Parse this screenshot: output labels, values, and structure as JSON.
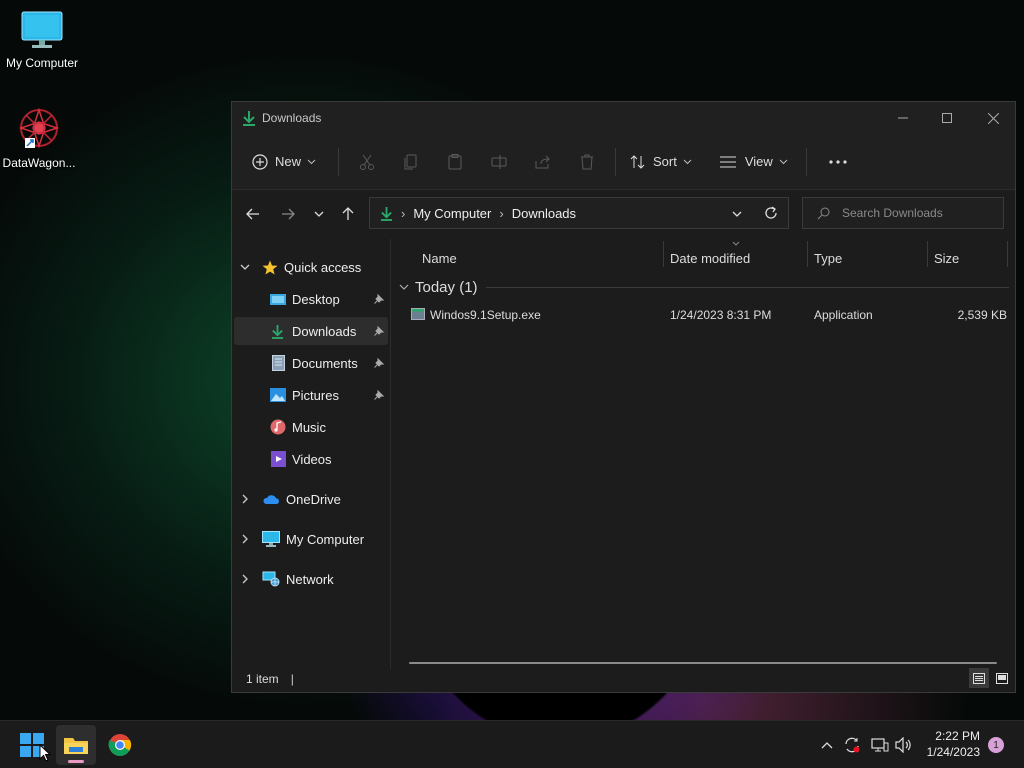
{
  "desktop": {
    "icons": [
      {
        "label": "My Computer"
      },
      {
        "label": "DataWagon..."
      }
    ]
  },
  "window": {
    "title": "Downloads",
    "toolbar": {
      "new_label": "New",
      "sort_label": "Sort",
      "view_label": "View"
    },
    "address": {
      "crumbs": [
        "My Computer",
        "Downloads"
      ],
      "search_placeholder": "Search Downloads"
    },
    "sidebar": {
      "quick_access": "Quick access",
      "items": [
        {
          "label": "Desktop",
          "pinned": true
        },
        {
          "label": "Downloads",
          "pinned": true,
          "selected": true
        },
        {
          "label": "Documents",
          "pinned": true
        },
        {
          "label": "Pictures",
          "pinned": true
        },
        {
          "label": "Music",
          "pinned": false
        },
        {
          "label": "Videos",
          "pinned": false
        }
      ],
      "roots": [
        "OneDrive",
        "My Computer",
        "Network"
      ]
    },
    "columns": [
      "Name",
      "Date modified",
      "Type",
      "Size"
    ],
    "group": "Today (1)",
    "files": [
      {
        "name": "Windos9.1Setup.exe",
        "date": "1/24/2023 8:31 PM",
        "type": "Application",
        "size": "2,539 KB"
      }
    ],
    "status": "1 item"
  },
  "taskbar": {
    "time": "2:22 PM",
    "date": "1/24/2023",
    "notification_count": "1"
  },
  "colors": {
    "accent": "#2aa86a",
    "window_bg": "#1c1c1c",
    "selected_bg": "#2d2d2d"
  }
}
